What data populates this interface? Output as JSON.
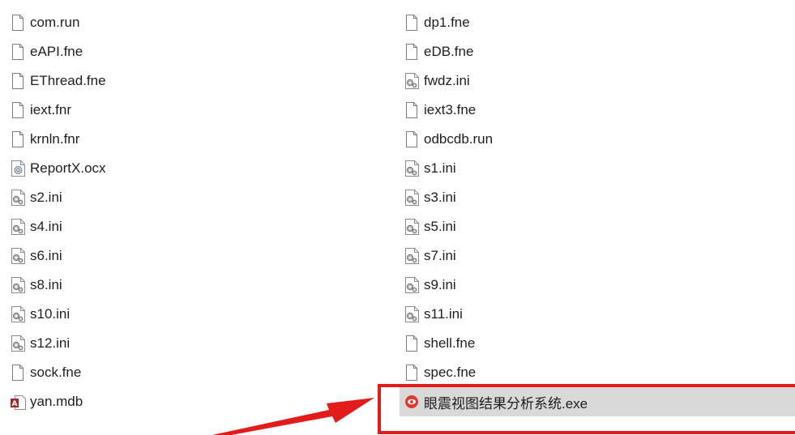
{
  "left_files": [
    {
      "name": "com.run",
      "icon": "blank-file-icon"
    },
    {
      "name": "eAPI.fne",
      "icon": "blank-file-icon"
    },
    {
      "name": "EThread.fne",
      "icon": "blank-file-icon"
    },
    {
      "name": "iext.fnr",
      "icon": "blank-file-icon"
    },
    {
      "name": "krnln.fnr",
      "icon": "blank-file-icon"
    },
    {
      "name": "ReportX.ocx",
      "icon": "activex-control-icon"
    },
    {
      "name": "s2.ini",
      "icon": "settings-file-icon"
    },
    {
      "name": "s4.ini",
      "icon": "settings-file-icon"
    },
    {
      "name": "s6.ini",
      "icon": "settings-file-icon"
    },
    {
      "name": "s8.ini",
      "icon": "settings-file-icon"
    },
    {
      "name": "s10.ini",
      "icon": "settings-file-icon"
    },
    {
      "name": "s12.ini",
      "icon": "settings-file-icon"
    },
    {
      "name": "sock.fne",
      "icon": "blank-file-icon"
    },
    {
      "name": "yan.mdb",
      "icon": "access-database-icon"
    }
  ],
  "right_files": [
    {
      "name": "dp1.fne",
      "icon": "blank-file-icon"
    },
    {
      "name": "eDB.fne",
      "icon": "blank-file-icon"
    },
    {
      "name": "fwdz.ini",
      "icon": "settings-file-icon"
    },
    {
      "name": "iext3.fne",
      "icon": "blank-file-icon"
    },
    {
      "name": "odbcdb.run",
      "icon": "blank-file-icon"
    },
    {
      "name": "s1.ini",
      "icon": "settings-file-icon"
    },
    {
      "name": "s3.ini",
      "icon": "settings-file-icon"
    },
    {
      "name": "s5.ini",
      "icon": "settings-file-icon"
    },
    {
      "name": "s7.ini",
      "icon": "settings-file-icon"
    },
    {
      "name": "s9.ini",
      "icon": "settings-file-icon"
    },
    {
      "name": "s11.ini",
      "icon": "settings-file-icon"
    },
    {
      "name": "shell.fne",
      "icon": "blank-file-icon"
    },
    {
      "name": "spec.fne",
      "icon": "blank-file-icon"
    },
    {
      "name": "眼震视图结果分析系统.exe",
      "icon": "app-executable-icon",
      "selected": true
    }
  ],
  "annotation": {
    "highlight_color": "#e21b1b",
    "selection_color": "#d9d9d9"
  }
}
